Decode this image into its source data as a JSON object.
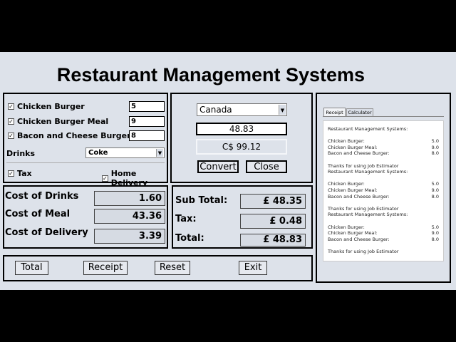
{
  "title": "Restaurant Management Systems",
  "meals": {
    "chicken_burger": {
      "label": "Chicken Burger",
      "value": "5",
      "checked": true
    },
    "chicken_burger_meal": {
      "label": "Chicken Burger Meal",
      "value": "9",
      "checked": true
    },
    "bacon_cheese_burger": {
      "label": "Bacon and Cheese Burger",
      "value": "8",
      "checked": true
    },
    "drinks_label": "Drinks",
    "drinks_selected": "Coke",
    "tax_label": "Tax",
    "home_delivery_label": "Home Delivery",
    "check_mark": "✓"
  },
  "converter": {
    "country": "Canada",
    "amount": "48.83",
    "result": "C$ 99.12",
    "convert_label": "Convert",
    "close_label": "Close"
  },
  "costs": {
    "drinks_label": "Cost of Drinks",
    "drinks_value": "1.60",
    "meal_label": "Cost of Meal",
    "meal_value": "43.36",
    "delivery_label": "Cost of Delivery",
    "delivery_value": "3.39"
  },
  "totals": {
    "subtotal_label": "Sub Total:",
    "subtotal_value": "£ 48.35",
    "tax_label": "Tax:",
    "tax_value": "£ 0.48",
    "total_label": "Total:",
    "total_value": "£ 48.83"
  },
  "buttons": {
    "total": "Total",
    "receipt": "Receipt",
    "reset": "Reset",
    "exit": "Exit"
  },
  "tabs": {
    "receipt": "Receipt",
    "calculator": "Calculator"
  },
  "receipt_lines": [
    {
      "text": "Restaurant Management Systems:",
      "value": ""
    },
    {
      "text": "",
      "value": ""
    },
    {
      "text": "Chicken Burger:",
      "value": "5.0"
    },
    {
      "text": "Chicken Burger Meal:",
      "value": "9.0"
    },
    {
      "text": "Bacon and Cheese Burger:",
      "value": "8.0"
    },
    {
      "text": "",
      "value": ""
    },
    {
      "text": "Thanks for  using Job Estimator",
      "value": ""
    },
    {
      "text": "Restaurant Management Systems:",
      "value": ""
    },
    {
      "text": "",
      "value": ""
    },
    {
      "text": "Chicken Burger:",
      "value": "5.0"
    },
    {
      "text": "Chicken Burger Meal:",
      "value": "9.0"
    },
    {
      "text": "Bacon and Cheese Burger:",
      "value": "8.0"
    },
    {
      "text": "",
      "value": ""
    },
    {
      "text": "Thanks for  using Job Estimator",
      "value": ""
    },
    {
      "text": "Restaurant Management Systems:",
      "value": ""
    },
    {
      "text": "",
      "value": ""
    },
    {
      "text": "Chicken Burger:",
      "value": "5.0"
    },
    {
      "text": "Chicken Burger Meal:",
      "value": "9.0"
    },
    {
      "text": "Bacon and Cheese Burger:",
      "value": "8.0"
    },
    {
      "text": "",
      "value": ""
    },
    {
      "text": "Thanks for  using Job Estimator",
      "value": ""
    }
  ]
}
